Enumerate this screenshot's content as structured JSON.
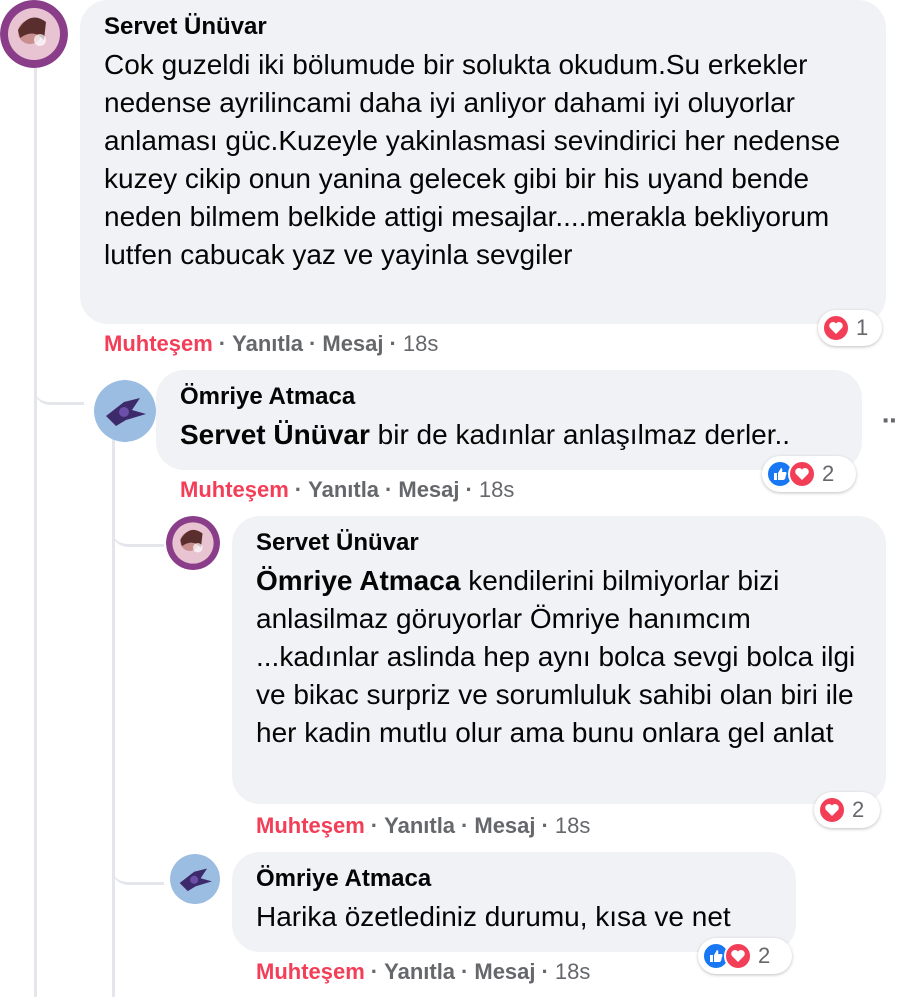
{
  "colors": {
    "react": "#f33e58",
    "like": "#1877f2",
    "bubble": "#f0f2f5",
    "meta": "#65676b"
  },
  "comments": [
    {
      "author": "Servet Ünüvar",
      "text": "Cok guzeldi iki bölumude bir solukta okudum.Su erkekler nedense ayrilincami daha iyi anliyor dahami iyi oluyorlar anlaması güc.Kuzeyle yakinlasmasi sevindirici her nedense kuzey cikip onun yanina gelecek gibi bir his uyand bende neden bilmem belkide attigi mesajlar....merakla bekliyorum lutfen cabucak yaz ve yayinla sevgiler",
      "react_label": "Muhteşem",
      "reply_label": "Yanıtla",
      "message_label": "Mesaj",
      "time": "18s",
      "reaction_icons": [
        "love-icon"
      ],
      "reaction_count": "1"
    },
    {
      "author": "Ömriye Atmaca",
      "mention": "Servet Ünüvar",
      "text": "bir de kadınlar anlaşılmaz derler..",
      "react_label": "Muhteşem",
      "reply_label": "Yanıtla",
      "message_label": "Mesaj",
      "time": "18s",
      "reaction_icons": [
        "like-icon",
        "love-icon"
      ],
      "reaction_count": "2"
    },
    {
      "author": "Servet Ünüvar",
      "mention": "Ömriye Atmaca",
      "text": "kendilerini bilmiyorlar bizi anlasilmaz göruyorlar Ömriye hanımcım ...kadınlar aslinda hep aynı bolca sevgi bolca ilgi ve bikac surpriz ve sorumluluk sahibi olan biri ile her kadin mutlu olur ama bunu onlara gel anlat",
      "react_label": "Muhteşem",
      "reply_label": "Yanıtla",
      "message_label": "Mesaj",
      "time": "18s",
      "reaction_icons": [
        "love-icon"
      ],
      "reaction_count": "2"
    },
    {
      "author": "Ömriye Atmaca",
      "text": "Harika özetlediniz durumu, kısa ve net",
      "react_label": "Muhteşem",
      "reply_label": "Yanıtla",
      "message_label": "Mesaj",
      "time": "18s",
      "reaction_icons": [
        "like-icon",
        "love-icon"
      ],
      "reaction_count": "2"
    }
  ]
}
